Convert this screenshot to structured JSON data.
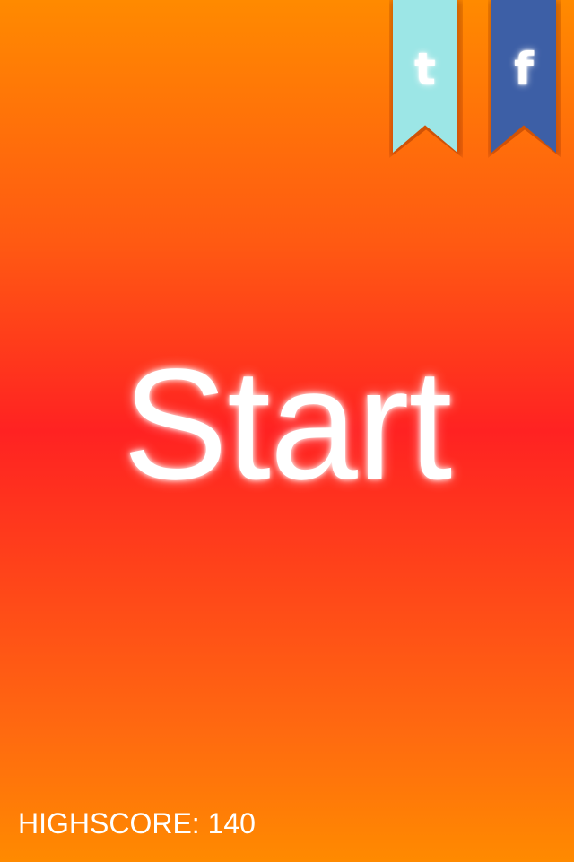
{
  "social": {
    "tumblr": {
      "icon": "tumblr-icon",
      "glyph": "t",
      "color": "#9ce6e6"
    },
    "facebook": {
      "icon": "facebook-icon",
      "glyph": "f",
      "color": "#3d5fa6"
    }
  },
  "main": {
    "start_label": "Start"
  },
  "footer": {
    "highscore_label": "HIGHSCORE:",
    "highscore_value": "140"
  },
  "theme": {
    "background_top": "#ff8a00",
    "background_middle": "#ff2222",
    "text_color": "#ffffff"
  }
}
